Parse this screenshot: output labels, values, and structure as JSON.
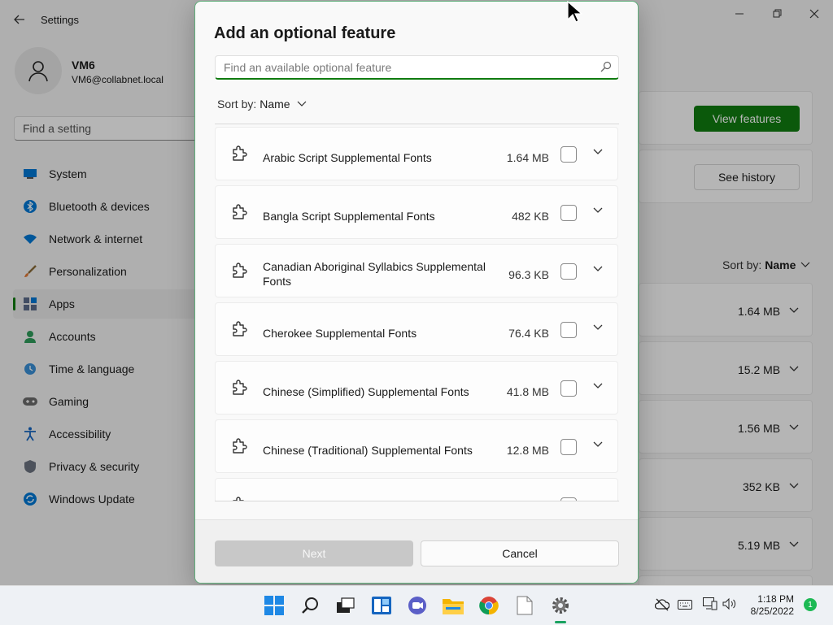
{
  "settings": {
    "window_title": "Settings",
    "user": {
      "name": "VM6",
      "email": "VM6@collabnet.local"
    },
    "search_placeholder": "Find a setting",
    "nav": [
      {
        "label": "System",
        "icon": "monitor-icon"
      },
      {
        "label": "Bluetooth & devices",
        "icon": "bluetooth-icon"
      },
      {
        "label": "Network & internet",
        "icon": "wifi-icon"
      },
      {
        "label": "Personalization",
        "icon": "brush-icon"
      },
      {
        "label": "Apps",
        "icon": "apps-icon",
        "active": true
      },
      {
        "label": "Accounts",
        "icon": "person-icon"
      },
      {
        "label": "Time & language",
        "icon": "clock-globe-icon"
      },
      {
        "label": "Gaming",
        "icon": "gamepad-icon"
      },
      {
        "label": "Accessibility",
        "icon": "accessibility-icon"
      },
      {
        "label": "Privacy & security",
        "icon": "shield-icon"
      },
      {
        "label": "Windows Update",
        "icon": "update-icon"
      }
    ],
    "view_features_label": "View features",
    "see_history_label": "See history",
    "sort_label": "Sort by:",
    "sort_value": "Name",
    "installed_sizes": [
      "1.64 MB",
      "15.2 MB",
      "1.56 MB",
      "352 KB",
      "5.19 MB"
    ]
  },
  "dialog": {
    "title": "Add an optional feature",
    "search_placeholder": "Find an available optional feature",
    "sort_label": "Sort by:",
    "sort_value": "Name",
    "features": [
      {
        "name": "Arabic Script Supplemental Fonts",
        "size": "1.64 MB"
      },
      {
        "name": "Bangla Script Supplemental Fonts",
        "size": "482 KB"
      },
      {
        "name": "Canadian Aboriginal Syllabics Supplemental Fonts",
        "size": "96.3 KB"
      },
      {
        "name": "Cherokee Supplemental Fonts",
        "size": "76.4 KB"
      },
      {
        "name": "Chinese (Simplified) Supplemental Fonts",
        "size": "41.8 MB"
      },
      {
        "name": "Chinese (Traditional) Supplemental Fonts",
        "size": "12.8 MB"
      }
    ],
    "next_label": "Next",
    "cancel_label": "Cancel"
  },
  "taskbar": {
    "time": "1:18 PM",
    "date": "8/25/2022",
    "notification_count": "1"
  },
  "colors": {
    "accent": "#107c10",
    "focus": "#0f7b0f"
  }
}
